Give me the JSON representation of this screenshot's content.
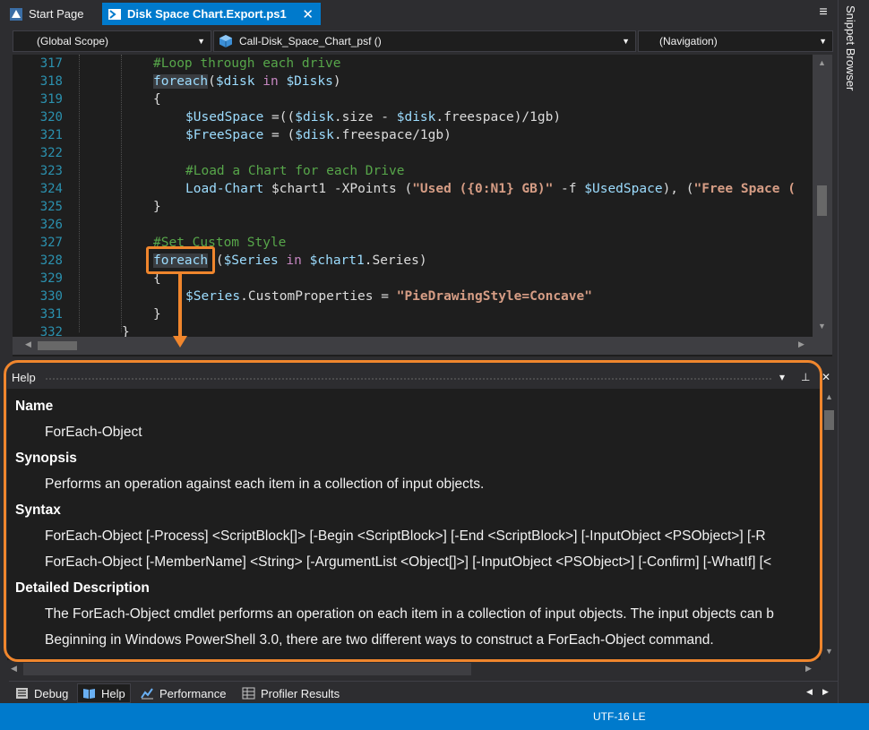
{
  "tabs": {
    "start_label": "Start Page",
    "active_label": "Disk Space Chart.Export.ps1",
    "close_glyph": "✕"
  },
  "sidebar_right": {
    "label": "Snippet Browser"
  },
  "navbar": {
    "scope": "(Global Scope)",
    "function": "Call-Disk_Space_Chart_psf ()",
    "navigation": "(Navigation)"
  },
  "editor": {
    "line_numbers": [
      "317",
      "318",
      "319",
      "320",
      "321",
      "322",
      "323",
      "324",
      "325",
      "326",
      "327",
      "328",
      "329",
      "330",
      "331",
      "332"
    ],
    "lines": {
      "l317": "#Loop through each drive",
      "l318_kw": "foreach",
      "l318_rest_a": "(",
      "l318_var1": "$disk",
      "l318_in": "in",
      "l318_var2": "$Disks",
      "l318_close": ")",
      "l319": "{",
      "l320_var": "$UsedSpace",
      "l320_a": " =((",
      "l320_v2": "$disk",
      "l320_b": ".size - ",
      "l320_v3": "$disk",
      "l320_c": ".freespace)/1gb)",
      "l321_var": "$FreeSpace",
      "l321_a": " = (",
      "l321_v2": "$disk",
      "l321_b": ".freespace/1gb)",
      "l323": "#Load a Chart for each Drive",
      "l324_cmd": "Load-Chart",
      "l324_v1": " $chart1",
      "l324_a": " -XPoints (",
      "l324_s1": "\"Used ({0:N1} GB)\"",
      "l324_b": " -f ",
      "l324_v2": "$UsedSpace",
      "l324_c": "), (",
      "l324_s2": "\"Free Space (",
      "l325": "}",
      "l327": "#Set Custom Style",
      "l328_kw": "foreach",
      "l328_a": " (",
      "l328_v1": "$Series",
      "l328_in": "in",
      "l328_v2": "$chart1",
      "l328_b": ".Series)",
      "l329": "{",
      "l330_v": "$Series",
      "l330_a": ".CustomProperties = ",
      "l330_s": "\"PieDrawingStyle=Concave\"",
      "l331": "}",
      "l332": "}"
    }
  },
  "help": {
    "title": "Help",
    "sections": {
      "name_head": "Name",
      "name_body": "ForEach-Object",
      "synopsis_head": "Synopsis",
      "synopsis_body": "Performs an operation against each item in a collection of input objects.",
      "syntax_head": "Syntax",
      "syntax_1": "ForEach-Object [-Process] <ScriptBlock[]> [-Begin <ScriptBlock>] [-End <ScriptBlock>] [-InputObject <PSObject>] [-R",
      "syntax_2": "ForEach-Object [-MemberName] <String> [-ArgumentList <Object[]>] [-InputObject <PSObject>] [-Confirm] [-WhatIf] [<",
      "desc_head": "Detailed Description",
      "desc_1": "The ForEach-Object cmdlet performs an operation on each item in a collection of input objects. The input objects can b",
      "desc_2": "Beginning in Windows PowerShell 3.0, there are two different ways to construct a ForEach-Object command."
    }
  },
  "tooltabs": {
    "debug": "Debug",
    "help": "Help",
    "performance": "Performance",
    "profiler": "Profiler Results"
  },
  "status": {
    "encoding": "UTF-16 LE"
  },
  "colors": {
    "accent": "#007acc",
    "annotation": "#f0862d"
  }
}
